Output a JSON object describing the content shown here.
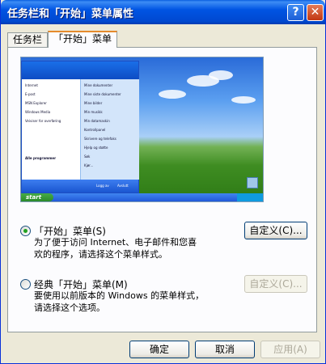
{
  "window": {
    "title": "任务栏和「开始」菜单属性",
    "help_glyph": "?",
    "close_glyph": "✕"
  },
  "tabs": [
    {
      "label": "任务栏",
      "active": false
    },
    {
      "label": "「开始」菜单",
      "active": true
    }
  ],
  "preview": {
    "start_button": "start",
    "start_menu_left": [
      "Internet",
      "E-post",
      "MSN Explorer",
      "Windows Media",
      "Veiviser for overføring"
    ],
    "start_menu_right": [
      "Mine dokumenter",
      "Mine siste dokumenter",
      "Mine bilder",
      "Min musikk",
      "Min datamaskin",
      "Kontrollpanel",
      "Skrivere og telefaks",
      "Hjelp og støtte",
      "Søk",
      "Kjør..."
    ],
    "all_programs": "Alle programmer",
    "logoff": "Logg av",
    "shutdown": "Avslutt"
  },
  "options": {
    "start_menu": {
      "label": "「开始」菜单(S)",
      "description": "为了便于访问 Internet、电子邮件和您喜\n欢的程序，请选择这个菜单样式。",
      "selected": true,
      "customize_label": "自定义(C)..."
    },
    "classic_menu": {
      "label": "经典「开始」菜单(M)",
      "description": "要使用以前版本的 Windows 的菜单样式，\n请选择这个选项。",
      "selected": false,
      "customize_label": "自定义(C)..."
    }
  },
  "footer": {
    "ok_label": "确定",
    "cancel_label": "取消",
    "apply_label": "应用(A)"
  },
  "colors": {
    "titlebar": "#0054e3",
    "dialog_bg": "#ece9d8",
    "radio_dot": "#21a121"
  }
}
